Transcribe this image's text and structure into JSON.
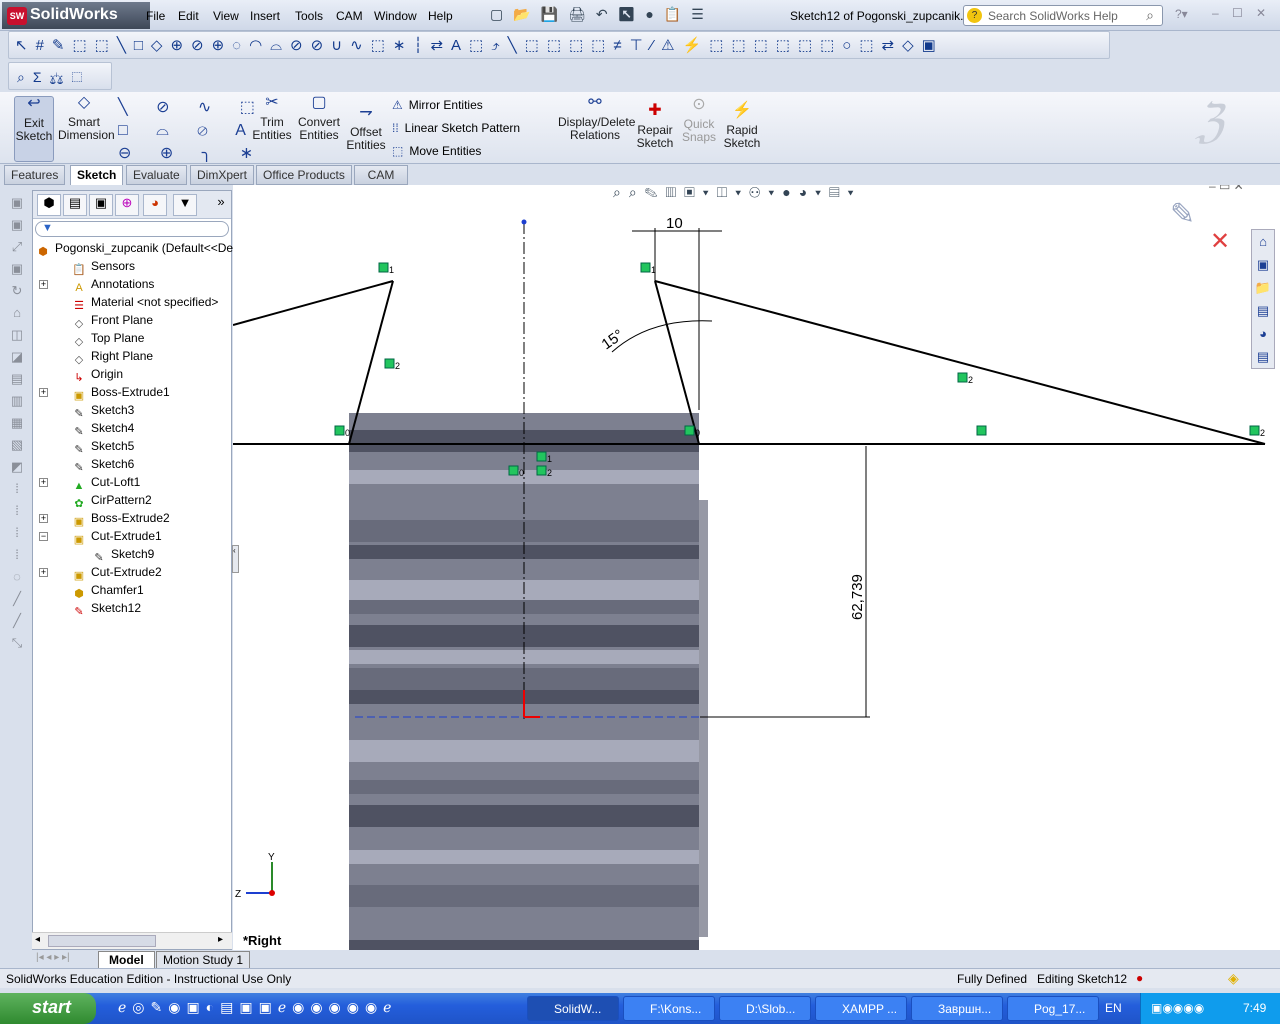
{
  "app": {
    "name": "SolidWorks",
    "document_title": "Sketch12 of Pogonski_zupcanik....",
    "search_placeholder": "Search SolidWorks Help"
  },
  "menu": [
    "File",
    "Edit",
    "View",
    "Insert",
    "Tools",
    "CAM",
    "Window",
    "Help"
  ],
  "command_manager": {
    "exit_sketch": "Exit Sketch",
    "smart_dimension": "Smart Dimension",
    "trim": "Trim Entities",
    "convert": "Convert Entities",
    "offset": "Offset Entities",
    "mirror": "Mirror Entities",
    "linear_pattern": "Linear Sketch Pattern",
    "move": "Move Entities",
    "relations": "Display/Delete Relations",
    "repair": "Repair Sketch",
    "quick_snaps": "Quick Snaps",
    "rapid": "Rapid Sketch"
  },
  "tabs": [
    "Features",
    "Sketch",
    "Evaluate",
    "DimXpert",
    "Office Products",
    "CAM"
  ],
  "active_tab": "Sketch",
  "tree": {
    "root": "Pogonski_zupcanik  (Default<<Defau",
    "items": [
      "Sensors",
      "Annotations",
      "Material <not specified>",
      "Front Plane",
      "Top Plane",
      "Right Plane",
      "Origin",
      "Boss-Extrude1",
      "Sketch3",
      "Sketch4",
      "Sketch5",
      "Sketch6",
      "Cut-Loft1",
      "CirPattern2",
      "Boss-Extrude2",
      "Cut-Extrude1",
      "Sketch9",
      "Cut-Extrude2",
      "Chamfer1",
      "Sketch12"
    ]
  },
  "viewport": {
    "view_name": "*Right",
    "dimensions": {
      "width": "10",
      "angle": "15°",
      "height": "62,739"
    },
    "relation_labels": [
      "1",
      "2",
      "0",
      "1",
      "2",
      "0",
      "2",
      "1",
      "2",
      "0",
      "2"
    ],
    "triad": {
      "y": "Y",
      "z": "Z"
    }
  },
  "bottom_tabs": [
    "Model",
    "Motion Study 1"
  ],
  "status": {
    "left": "SolidWorks Education Edition - Instructional Use Only",
    "state": "Fully Defined",
    "editing": "Editing Sketch12"
  },
  "taskbar": {
    "start": "start",
    "tasks": [
      "SolidW...",
      "F:\\Kons...",
      "D:\\Slob...",
      "XAMPP ...",
      "Завршн...",
      "Pog_17..."
    ],
    "lang": "EN",
    "clock": "7:49"
  },
  "colors": {
    "sketch_line": "#000000",
    "relation_icon": "#22c55e",
    "accent": "#1c3f94"
  }
}
